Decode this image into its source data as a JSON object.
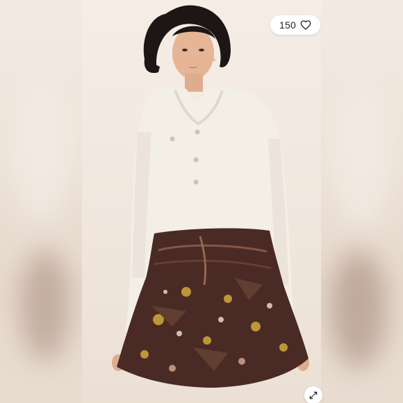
{
  "listing": {
    "likes": "150",
    "like_icon": "heart-outline-icon",
    "expand_icon": "expand-arrows-icon"
  },
  "colors": {
    "background": "#efe6dd",
    "sweater": "#f4efe6",
    "skirt_base": "#4a2a24",
    "skirt_accent": "#c9a23a",
    "hair": "#1c1714",
    "skin": "#e6b596"
  }
}
